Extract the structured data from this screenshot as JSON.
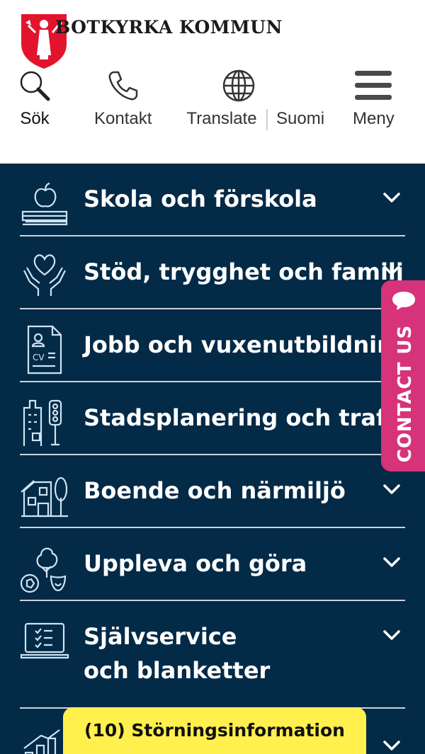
{
  "brand": {
    "name": "BOTKYRKA KOMMUN",
    "logo_icon": "botkyrka-coat-of-arms",
    "color": "#e2142d"
  },
  "toolbar": {
    "search_label": "Sök",
    "contact_label": "Kontakt",
    "translate_label": "Translate",
    "finnish_label": "Suomi",
    "menu_label": "Meny"
  },
  "nav": {
    "background": "#032a47",
    "items": [
      {
        "label": "Skola och förskola",
        "icon": "apple-book-icon"
      },
      {
        "label": "Stöd, trygghet och familj",
        "icon": "hands-heart-icon"
      },
      {
        "label": "Jobb och vuxenutbildning",
        "icon": "cv-document-icon"
      },
      {
        "label": "Stadsplanering och trafik",
        "icon": "city-traffic-light-icon"
      },
      {
        "label": "Boende och närmiljö",
        "icon": "house-tree-icon"
      },
      {
        "label": "Uppleva och göra",
        "icon": "tree-ball-masks-icon"
      },
      {
        "label_line1": "Självservice",
        "label_line2": "och blanketter",
        "icon": "laptop-checklist-icon"
      },
      {
        "label": "",
        "icon": "bar-chart-icon"
      }
    ]
  },
  "contact_tab": {
    "label": "CONTACT US",
    "color": "#d6337a",
    "icon": "chat-bubble-icon"
  },
  "alert": {
    "label": "(10) Störningsinformation",
    "color": "#fff04d"
  }
}
